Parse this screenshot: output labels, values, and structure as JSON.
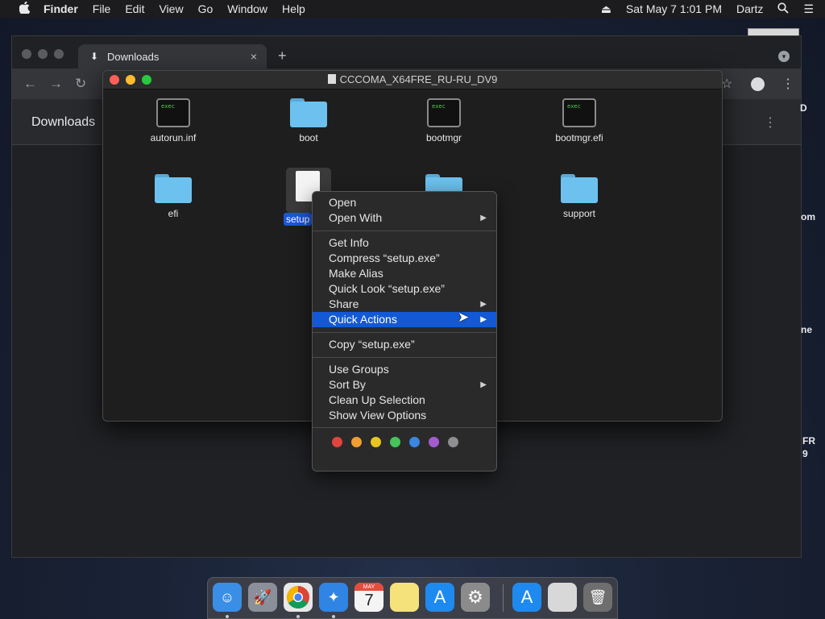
{
  "menubar": {
    "apple": "",
    "items": [
      "Finder",
      "File",
      "Edit",
      "View",
      "Go",
      "Window",
      "Help"
    ],
    "datetime": "Sat May 7  1:01 PM",
    "user": "Dartz",
    "icons": [
      "eject-icon",
      "search-icon",
      "list-icon"
    ]
  },
  "chrome": {
    "tab_title": "Downloads",
    "tab_close": "×",
    "new_tab": "+",
    "page_title": "Downloads",
    "partial_text": [
      "D",
      "om",
      "ne",
      "FR",
      "9"
    ]
  },
  "finder": {
    "title": "CCCOMA_X64FRE_RU-RU_DV9",
    "items": [
      {
        "name": "autorun.inf",
        "kind": "exec"
      },
      {
        "name": "boot",
        "kind": "folder"
      },
      {
        "name": "bootmgr",
        "kind": "exec"
      },
      {
        "name": "bootmgr.efi",
        "kind": "exec"
      },
      {
        "name": "efi",
        "kind": "folder"
      },
      {
        "name": "setup",
        "kind": "file",
        "selected": true
      },
      {
        "name": "",
        "kind": "folder"
      },
      {
        "name": "support",
        "kind": "folder"
      }
    ],
    "exec_label": "exec"
  },
  "context_menu": {
    "groups": [
      [
        "Open",
        "Open With"
      ],
      [
        "Get Info",
        "Compress “setup.exe”",
        "Make Alias",
        "Quick Look “setup.exe”",
        "Share",
        "Quick Actions"
      ],
      [
        "Copy “setup.exe”"
      ],
      [
        "Use Groups",
        "Sort By",
        "Clean Up Selection",
        "Show View Options"
      ]
    ],
    "highlighted": "Quick Actions",
    "submenus": [
      "Open With",
      "Share",
      "Quick Actions",
      "Sort By"
    ],
    "tag_colors": [
      "#e0443e",
      "#f0a030",
      "#e8c520",
      "#46c35a",
      "#3a86e0",
      "#a55bd0",
      "#8e8e93"
    ]
  },
  "dock": {
    "apps": [
      {
        "name": "Finder",
        "icon": "finder-icon",
        "color": "#3a8ee6",
        "running": true
      },
      {
        "name": "Launchpad",
        "icon": "launchpad-icon",
        "color": "#8a8f99",
        "running": false
      },
      {
        "name": "Chrome",
        "icon": "chrome-icon",
        "color": "#e8e8e8",
        "running": true
      },
      {
        "name": "Safari",
        "icon": "safari-icon",
        "color": "#2f84e4",
        "running": true
      },
      {
        "name": "Calendar",
        "icon": "calendar-icon",
        "color": "#f4f4f4",
        "running": false,
        "day": "7",
        "month": "MAY"
      },
      {
        "name": "Notes",
        "icon": "notes-icon",
        "color": "#f5e27a",
        "running": false
      },
      {
        "name": "App Store",
        "icon": "app-store-icon",
        "color": "#1e8af0",
        "running": false
      },
      {
        "name": "System Preferences",
        "icon": "gear-icon",
        "color": "#8b8b8b",
        "running": false
      },
      {
        "name": "App Store Downloads",
        "icon": "downloads-stack-icon",
        "color": "#1e8af0",
        "running": false
      },
      {
        "name": "Document",
        "icon": "document-icon",
        "color": "#d8d8d8",
        "running": false
      },
      {
        "name": "Trash",
        "icon": "trash-icon",
        "color": "#6e6e6e",
        "running": false
      }
    ]
  }
}
